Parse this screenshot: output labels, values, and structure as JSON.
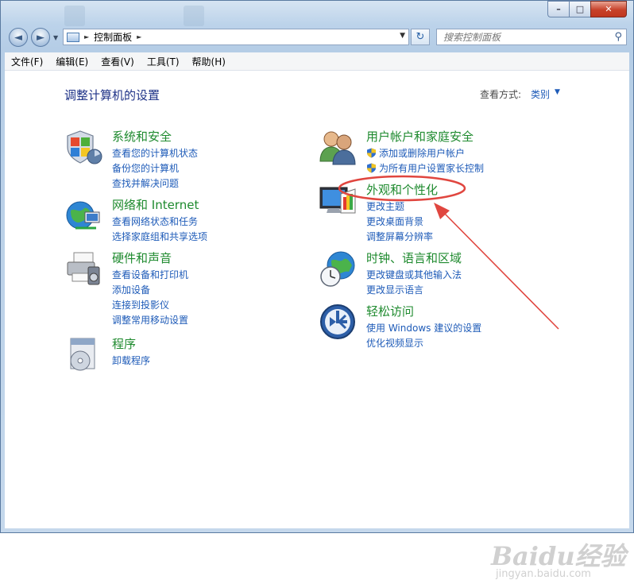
{
  "window": {
    "min_label": "–",
    "max_label": "□",
    "close_label": "✕"
  },
  "nav": {
    "back_glyph": "◄",
    "forward_glyph": "►"
  },
  "address": {
    "crumb": "控制面板"
  },
  "search": {
    "placeholder": "搜索控制面板",
    "icon": "search-icon"
  },
  "menu": {
    "items": [
      "文件(F)",
      "编辑(E)",
      "查看(V)",
      "工具(T)",
      "帮助(H)"
    ]
  },
  "page": {
    "title": "调整计算机的设置",
    "view_by_label": "查看方式:",
    "view_by_value": "类别"
  },
  "categories": [
    {
      "id": "system-security",
      "icon": "shield-flag-icon",
      "heading": "系统和安全",
      "links": [
        "查看您的计算机状态",
        "备份您的计算机",
        "查找并解决问题"
      ]
    },
    {
      "id": "network-internet",
      "icon": "globe-network-icon",
      "heading": "网络和 Internet",
      "links": [
        "查看网络状态和任务",
        "选择家庭组和共享选项"
      ]
    },
    {
      "id": "hardware-sound",
      "icon": "printer-speaker-icon",
      "heading": "硬件和声音",
      "links": [
        "查看设备和打印机",
        "添加设备",
        "连接到投影仪",
        "调整常用移动设置"
      ]
    },
    {
      "id": "programs",
      "icon": "programs-disc-icon",
      "heading": "程序",
      "links": [
        "卸载程序"
      ]
    },
    {
      "id": "user-accounts",
      "icon": "users-icon",
      "heading": "用户帐户和家庭安全",
      "links": [
        "添加或删除用户帐户",
        "为所有用户设置家长控制"
      ]
    },
    {
      "id": "appearance",
      "icon": "monitor-palette-icon",
      "heading": "外观和个性化",
      "links": [
        "更改主题",
        "更改桌面背景",
        "调整屏幕分辨率"
      ]
    },
    {
      "id": "clock-language",
      "icon": "globe-clock-icon",
      "heading": "时钟、语言和区域",
      "links": [
        "更改键盘或其他输入法",
        "更改显示语言"
      ]
    },
    {
      "id": "ease-of-access",
      "icon": "ease-of-access-icon",
      "heading": "轻松访问",
      "links": [
        "使用 Windows 建议的设置",
        "优化视频显示"
      ]
    }
  ],
  "annotation": {
    "color": "#e0463f"
  },
  "watermark": {
    "brand": "Baidu经验",
    "url": "jingyan.baidu.com"
  }
}
